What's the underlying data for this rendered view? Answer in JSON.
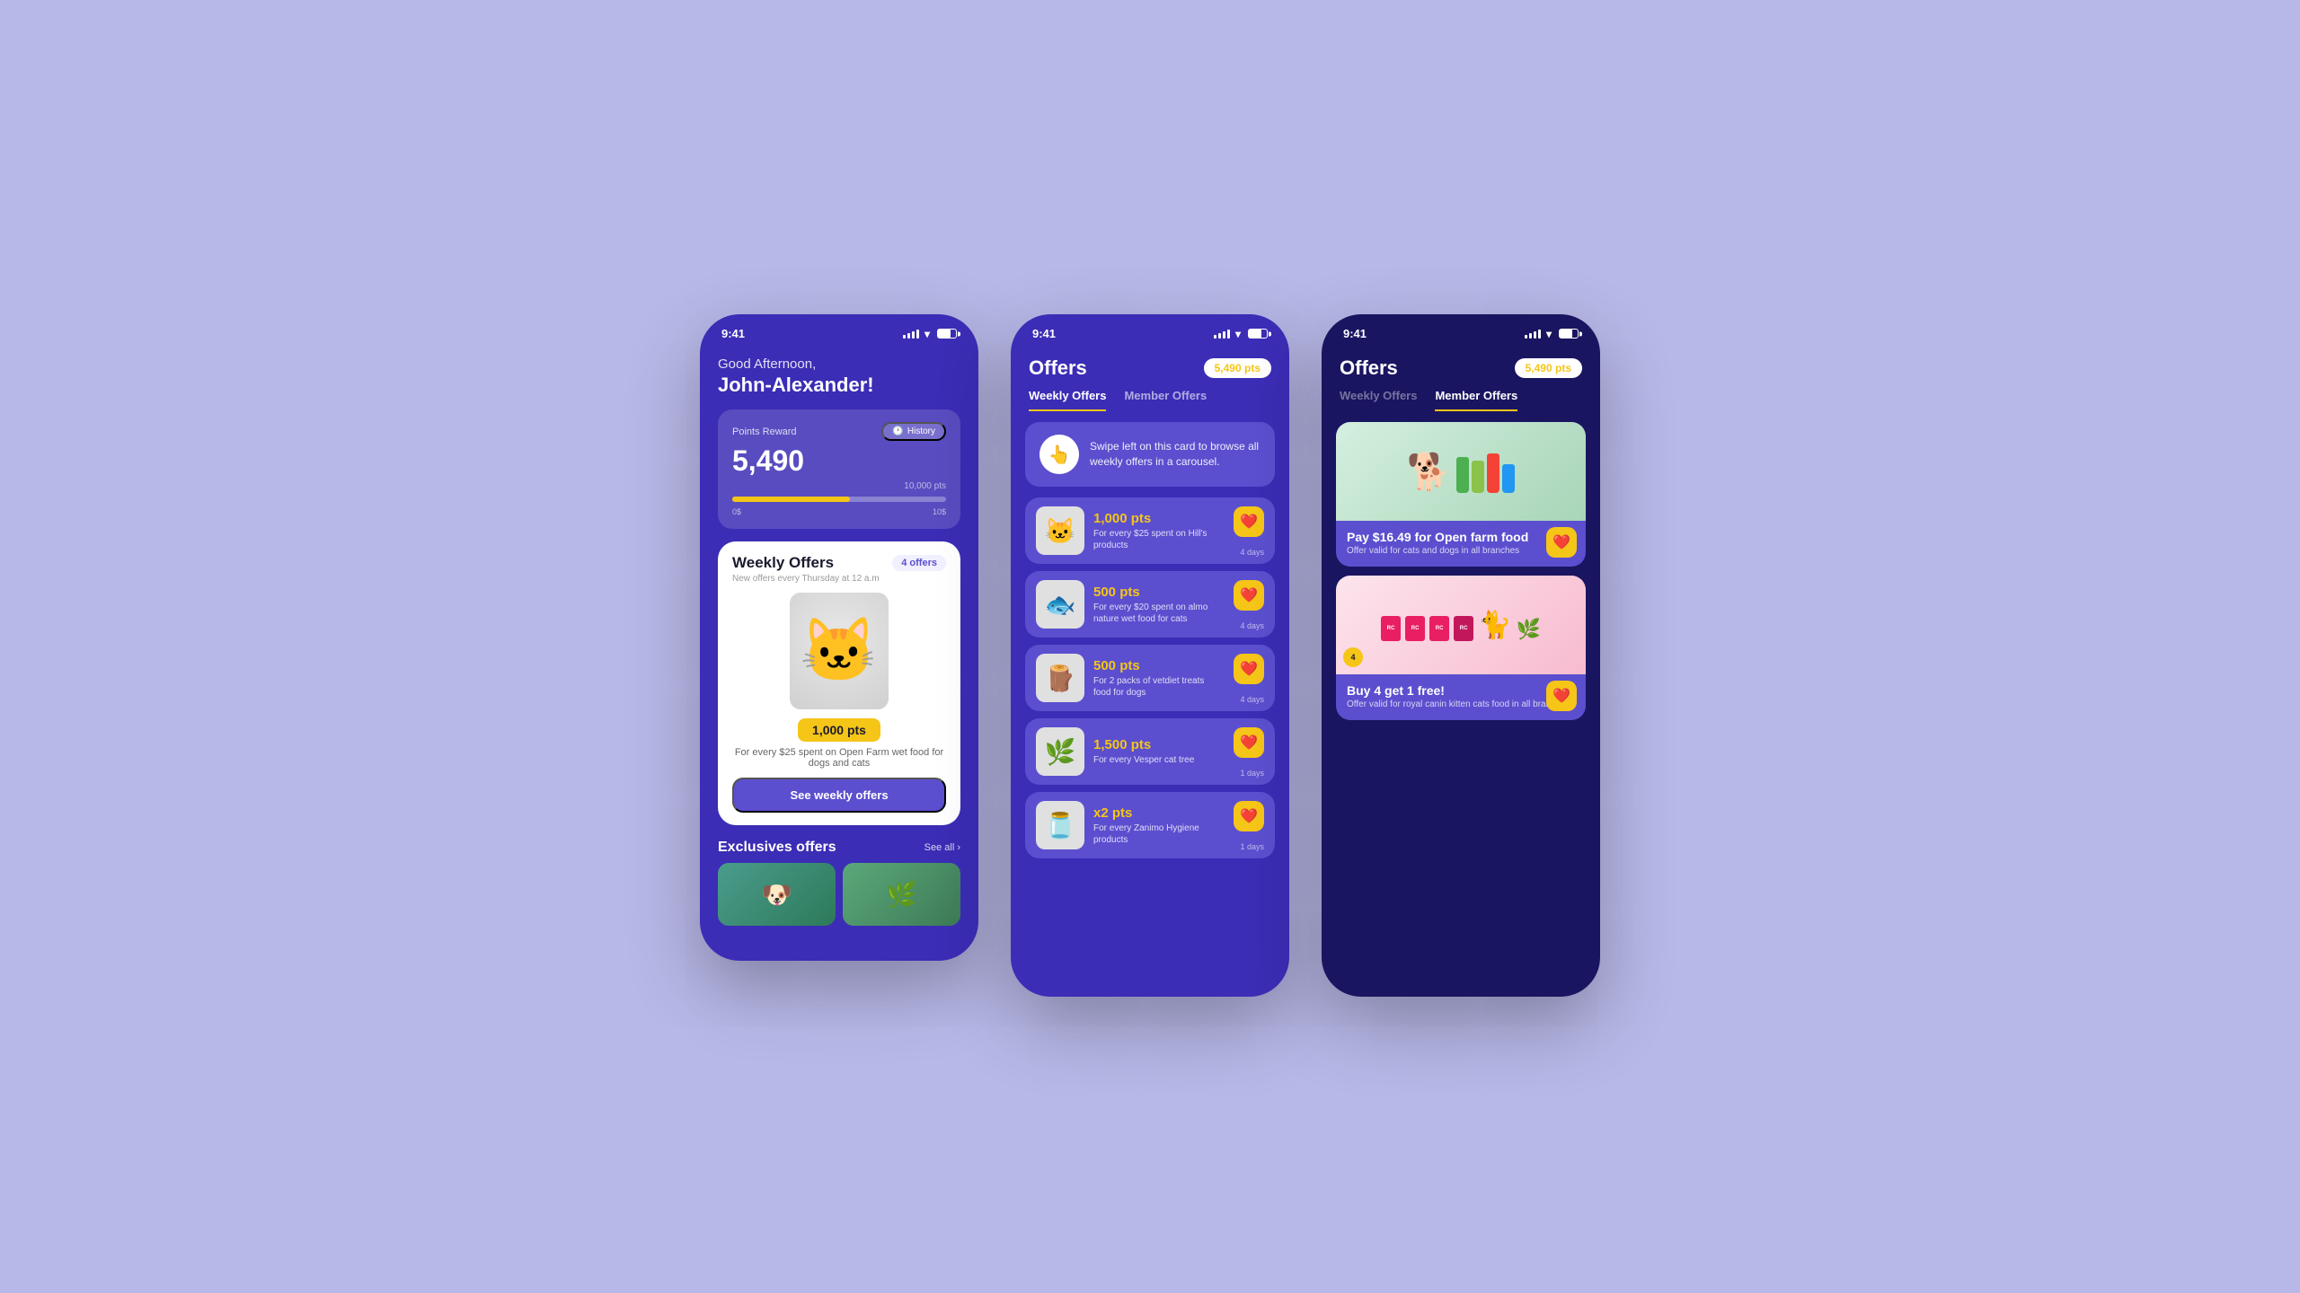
{
  "background": "#b8b8e8",
  "screens": {
    "screen1": {
      "status_time": "9:41",
      "greeting": "Good Afternoon,",
      "user_name": "John-Alexander!",
      "points_label": "Points Reward",
      "history_btn": "History",
      "points_value": "5,490",
      "points_max": "10,000 pts",
      "progress_min": "0$",
      "progress_max": "10$",
      "weekly_offers_title": "Weekly Offers",
      "weekly_offers_badge": "4 offers",
      "weekly_subtitle": "New offers every Thursday at 12 a.m",
      "points_badge": "1,000 pts",
      "offer_description": "For every $25 spent on Open Farm wet food for dogs and cats",
      "see_offers_btn": "See weekly offers",
      "exclusives_title": "Exclusives offers",
      "see_all": "See all ›"
    },
    "screen2": {
      "status_time": "9:41",
      "title": "Offers",
      "points_display": "5,490 pts",
      "tab_weekly": "Weekly Offers",
      "tab_member": "Member Offers",
      "swipe_text": "Swipe left on this card to browse all weekly offers in a carousel.",
      "offers": [
        {
          "pts": "1,000 pts",
          "desc": "For every $25 spent on Hill's products",
          "days": "4 days",
          "emoji": "🐱"
        },
        {
          "pts": "500 pts",
          "desc": "For every $20 spent on almo nature wet food for cats",
          "days": "4 days",
          "emoji": "🐟"
        },
        {
          "pts": "500 pts",
          "desc": "For 2 packs of vetdiet treats food for dogs",
          "days": "4 days",
          "emoji": "🪵"
        },
        {
          "pts": "1,500 pts",
          "desc": "For every Vesper cat tree",
          "days": "1 days",
          "emoji": "🌿"
        },
        {
          "pts": "x2 pts",
          "desc": "For every Zanimo Hygiene products",
          "days": "1 days",
          "emoji": "🫙"
        }
      ]
    },
    "screen3": {
      "status_time": "9:41",
      "title": "Offers",
      "points_display": "5,490 pts",
      "tab_weekly": "Weekly Offers",
      "tab_member": "Member Offers",
      "member_offers": [
        {
          "title": "Pay $16.49 for Open farm food",
          "subtitle": "Offer valid for cats and dogs in all branches"
        },
        {
          "title": "Buy 4 get 1 free!",
          "subtitle": "Offer valid for royal canin kitten cats food in all bran..."
        }
      ]
    }
  }
}
